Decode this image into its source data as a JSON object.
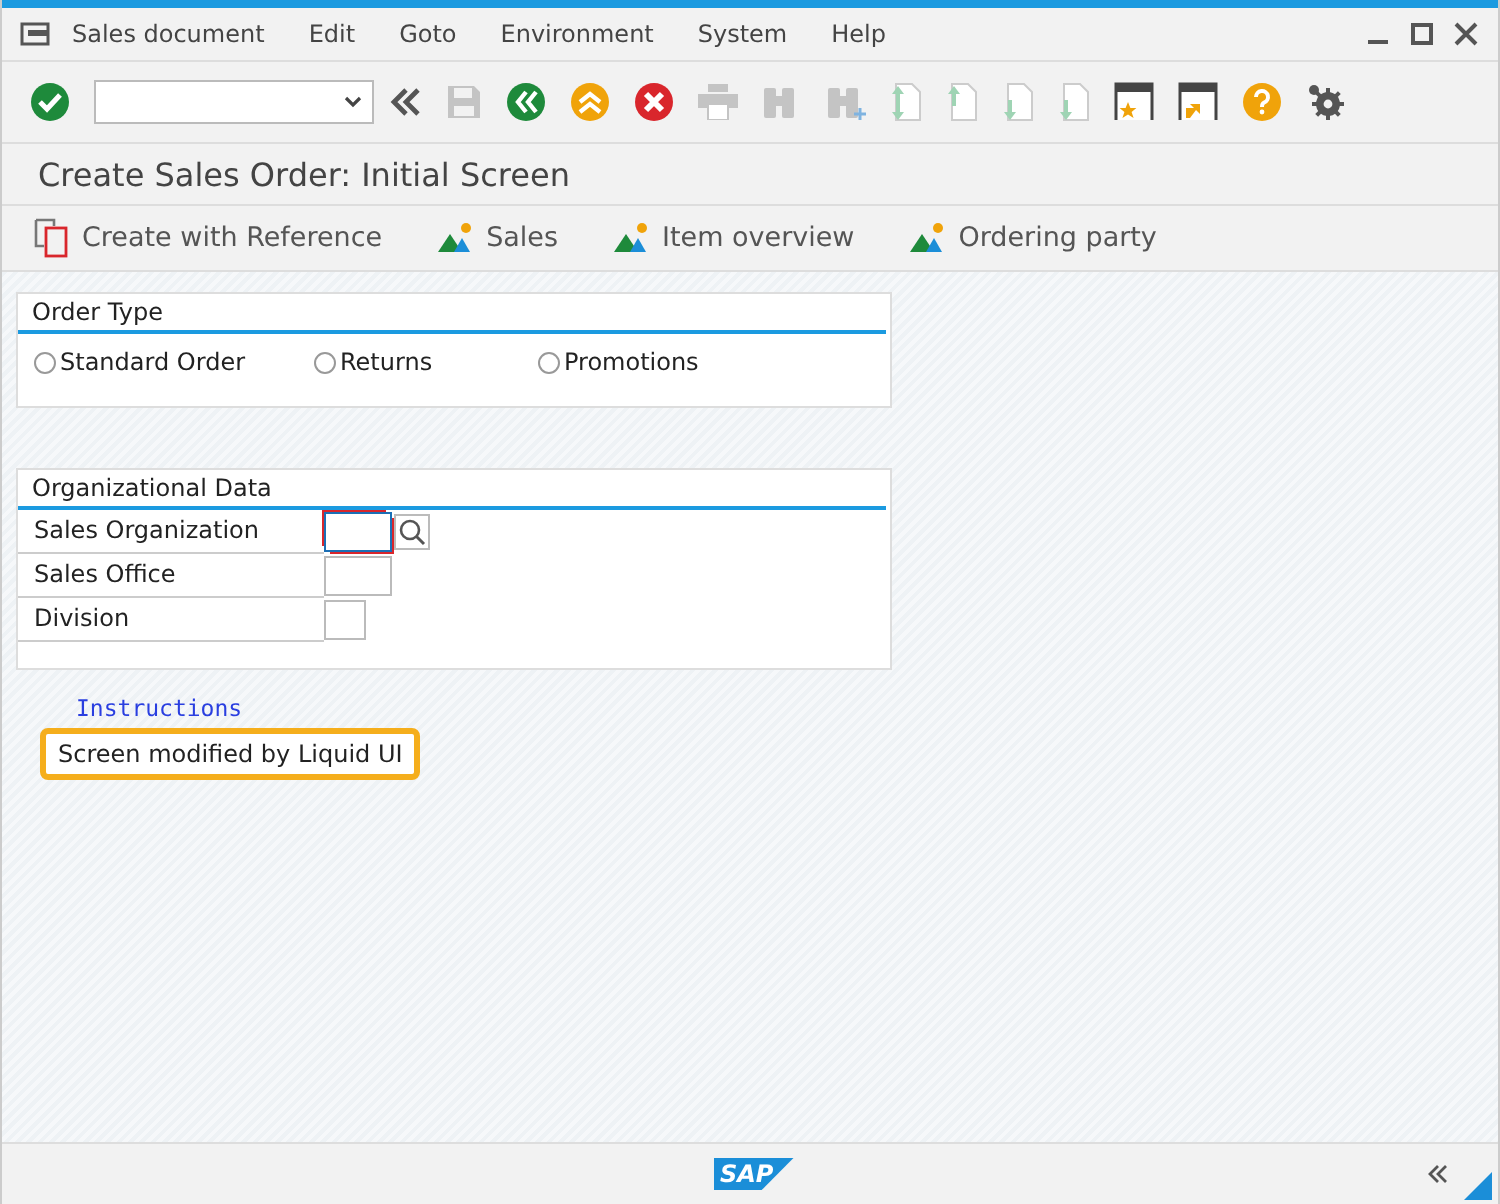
{
  "menu_bar": [
    "Sales document",
    "Edit",
    "Goto",
    "Environment",
    "System",
    "Help"
  ],
  "toolbar": [
    {
      "kind": "enter",
      "disabled": false
    },
    {
      "kind": "command-field",
      "disabled": false
    },
    {
      "kind": "collapse",
      "disabled": false
    },
    {
      "kind": "save",
      "disabled": true
    },
    {
      "kind": "back",
      "disabled": false
    },
    {
      "kind": "exit",
      "disabled": false
    },
    {
      "kind": "cancel",
      "disabled": false
    },
    {
      "kind": "print",
      "disabled": true
    },
    {
      "kind": "find",
      "disabled": true
    },
    {
      "kind": "find-next",
      "disabled": true
    },
    {
      "kind": "first-page",
      "disabled": true
    },
    {
      "kind": "prev-page",
      "disabled": true
    },
    {
      "kind": "next-page",
      "disabled": true
    },
    {
      "kind": "last-page",
      "disabled": true
    },
    {
      "kind": "new-session",
      "disabled": false
    },
    {
      "kind": "shortcut",
      "disabled": false
    },
    {
      "kind": "help",
      "disabled": false
    },
    {
      "kind": "settings",
      "disabled": false
    }
  ],
  "title": "Create Sales Order: Initial Screen",
  "app_toolbar": [
    {
      "kind": "reference",
      "label": "Create with Reference"
    },
    {
      "kind": "overview",
      "label": "Sales"
    },
    {
      "kind": "overview",
      "label": "Item overview"
    },
    {
      "kind": "overview",
      "label": "Ordering party"
    }
  ],
  "order_type": {
    "title": "Order Type",
    "options": [
      {
        "label": "Standard Order",
        "selected": false
      },
      {
        "label": "Returns",
        "selected": false
      },
      {
        "label": "Promotions",
        "selected": false
      }
    ]
  },
  "organizational_data": {
    "title": "Organizational Data",
    "fields": [
      {
        "label": "Sales Organization",
        "focused": true,
        "search_help": true
      },
      {
        "label": "Sales Office",
        "focused": false,
        "search_help": false
      },
      {
        "label": "Division",
        "focused": false,
        "search_help": false
      }
    ]
  },
  "instructions": {
    "title": "Instructions",
    "text": "Screen modified by Liquid UI"
  },
  "status_bar": {
    "logo": "SAP"
  }
}
